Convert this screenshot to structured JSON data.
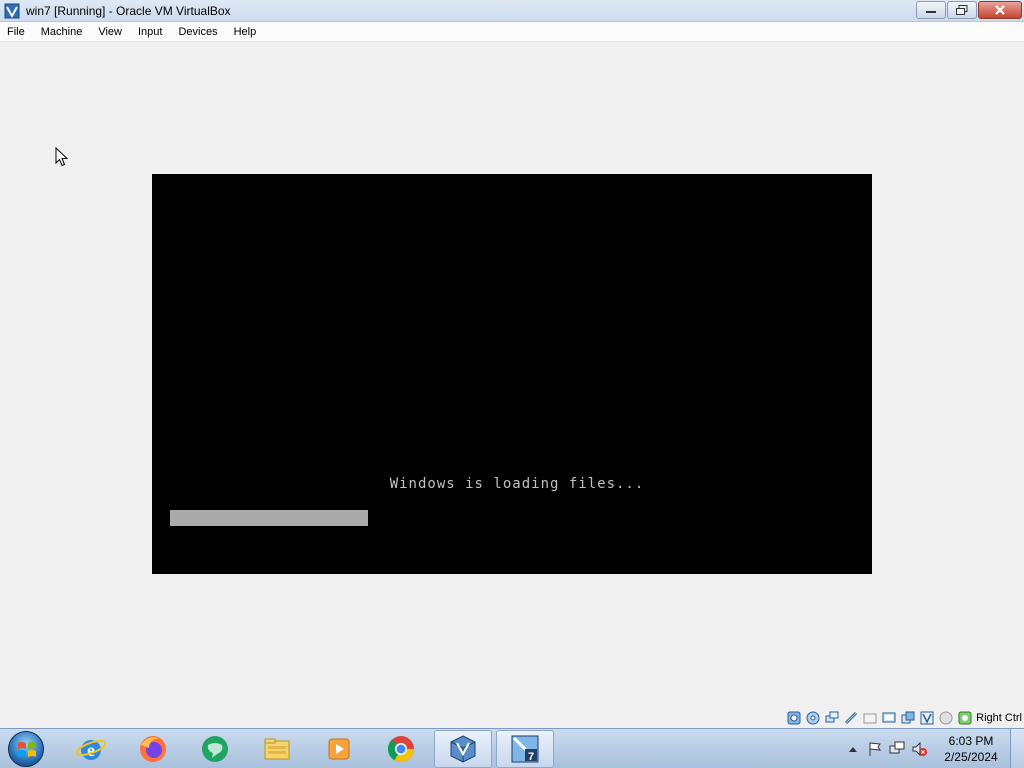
{
  "window": {
    "title": "win7 [Running] - Oracle VM VirtualBox"
  },
  "menu": {
    "items": [
      "File",
      "Machine",
      "View",
      "Input",
      "Devices",
      "Help"
    ]
  },
  "vm": {
    "boot_message": "Windows is loading files...",
    "progress_fraction": 0.29,
    "cursor_icon": "arrow-cursor-icon"
  },
  "statusbar": {
    "icons": [
      "hard-disk-icon",
      "optical-drive-icon",
      "network-icon",
      "usb-icon",
      "shared-folders-icon",
      "display-icon",
      "video-capture-icon",
      "virtualization-icon",
      "mouse-integration-icon",
      "keyboard-icon"
    ],
    "host_key": "Right Ctrl"
  },
  "taskbar": {
    "start_icon": "windows-start-icon",
    "pinned": [
      {
        "name": "internet-explorer-icon",
        "active": false
      },
      {
        "name": "firefox-icon",
        "active": false
      },
      {
        "name": "chat-app-icon",
        "active": false
      },
      {
        "name": "file-explorer-icon",
        "active": false
      },
      {
        "name": "media-player-icon",
        "active": false
      },
      {
        "name": "chrome-icon",
        "active": false
      },
      {
        "name": "virtualbox-icon",
        "active": true
      },
      {
        "name": "virtualbox-vm-win7-icon",
        "active": true
      }
    ],
    "tray_icons": [
      "show-hidden-icons-arrow",
      "action-center-flag-icon",
      "network-icon",
      "volume-muted-icon"
    ],
    "time": "6:03 PM",
    "date": "2/25/2024"
  },
  "colors": {
    "vm_background": "#000000",
    "boot_text": "#c0c0c0",
    "progress_fill": "#aaaaaa",
    "host_background": "#f0f0f0"
  }
}
